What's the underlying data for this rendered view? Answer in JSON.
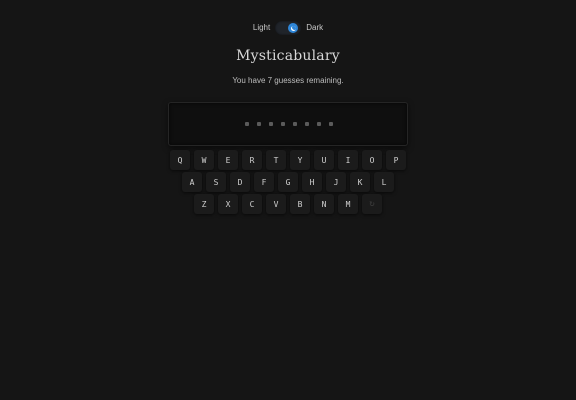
{
  "theme": {
    "light_label": "Light",
    "dark_label": "Dark",
    "selected": "Dark",
    "accent": "#2e86d8"
  },
  "title": "Mysticabulary",
  "status_text": "You have 7 guesses remaining.",
  "word_slots": 8,
  "keyboard": {
    "rows": [
      [
        "Q",
        "W",
        "E",
        "R",
        "T",
        "Y",
        "U",
        "I",
        "O",
        "P"
      ],
      [
        "A",
        "S",
        "D",
        "F",
        "G",
        "H",
        "J",
        "K",
        "L"
      ],
      [
        "Z",
        "X",
        "C",
        "V",
        "B",
        "N",
        "M"
      ]
    ],
    "reset_icon": "refresh-icon"
  }
}
